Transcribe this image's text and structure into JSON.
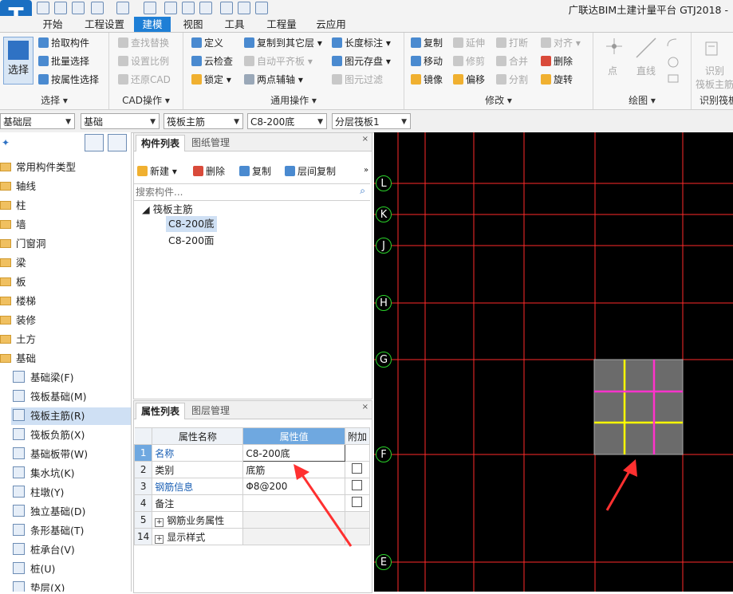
{
  "app": {
    "title": "广联达BIM土建计量平台 GTJ2018 -",
    "logo": "T"
  },
  "tabs": [
    {
      "label": "开始"
    },
    {
      "label": "工程设置"
    },
    {
      "label": "建模",
      "active": true
    },
    {
      "label": "视图"
    },
    {
      "label": "工具"
    },
    {
      "label": "工程量"
    },
    {
      "label": "云应用"
    }
  ],
  "ribbon": {
    "select": {
      "big": "选择",
      "items": [
        "拾取构件",
        "批量选择",
        "按属性选择"
      ],
      "group": "选择"
    },
    "cad": {
      "items": [
        "查找替换",
        "设置比例",
        "还原CAD"
      ],
      "group": "CAD操作"
    },
    "common": {
      "col1": [
        "定义",
        "云检查",
        "锁定"
      ],
      "col2": [
        "复制到其它层",
        "自动平齐板",
        "两点辅轴"
      ],
      "col3": [
        "长度标注",
        "图元存盘",
        "图元过滤"
      ],
      "group": "通用操作"
    },
    "modify": {
      "col1": [
        "复制",
        "移动",
        "镜像"
      ],
      "col2": [
        "延伸",
        "修剪",
        "偏移"
      ],
      "col3": [
        "打断",
        "合并",
        "分割"
      ],
      "col4": [
        "对齐",
        "删除",
        "旋转"
      ],
      "group": "修改"
    },
    "draw": {
      "items": [
        "点",
        "直线"
      ],
      "group": "绘图"
    },
    "recognize": {
      "item": "识别",
      "item2": "筏板主筋",
      "group": "识别筏板"
    }
  },
  "dropdowns": [
    "基础层",
    "基础",
    "筏板主筋",
    "C8-200底",
    "分层筏板1"
  ],
  "tree": {
    "folders": [
      "常用构件类型",
      "轴线",
      "柱",
      "墙",
      "门窗洞",
      "梁",
      "板",
      "楼梯",
      "装修",
      "土方",
      "基础"
    ],
    "children": [
      "基础梁(F)",
      "筏板基础(M)",
      "筏板主筋(R)",
      "筏板负筋(X)",
      "基础板带(W)",
      "集水坑(K)",
      "柱墩(Y)",
      "独立基础(D)",
      "条形基础(T)",
      "桩承台(V)",
      "桩(U)",
      "垫层(X)"
    ],
    "selected_index": 2
  },
  "component_panel": {
    "tabs": [
      "构件列表",
      "图纸管理"
    ],
    "toolbar": [
      "新建",
      "删除",
      "复制",
      "层间复制"
    ],
    "search_placeholder": "搜索构件...",
    "group": "筏板主筋",
    "items": [
      "C8-200底",
      "C8-200面"
    ],
    "selected_index": 0
  },
  "props_panel": {
    "tabs": [
      "属性列表",
      "图层管理"
    ],
    "headers": [
      "属性名称",
      "属性值",
      "附加"
    ],
    "rows": [
      {
        "num": "1",
        "name": "名称",
        "value": "C8-200底",
        "check": false
      },
      {
        "num": "2",
        "name": "类别",
        "value": "底筋",
        "check": true
      },
      {
        "num": "3",
        "name": "钢筋信息",
        "value": "Φ8@200",
        "check": true
      },
      {
        "num": "4",
        "name": "备注",
        "value": "",
        "check": true
      },
      {
        "num": "5",
        "name": "钢筋业务属性",
        "value": "",
        "check": false,
        "expand": true
      },
      {
        "num": "14",
        "name": "显示样式",
        "value": "",
        "check": false,
        "expand": true
      }
    ]
  },
  "canvas": {
    "axes": [
      "L",
      "K",
      "J",
      "H",
      "G",
      "F",
      "E"
    ],
    "colors": {
      "background": "#000000",
      "grid": "#ff2a2a",
      "axis_circle": "#2bd42b",
      "slab": "#6b6b6b",
      "bottom_rebar": "#ffff00",
      "top_rebar": "#ff33cc",
      "arrow": "#ff3030"
    }
  }
}
